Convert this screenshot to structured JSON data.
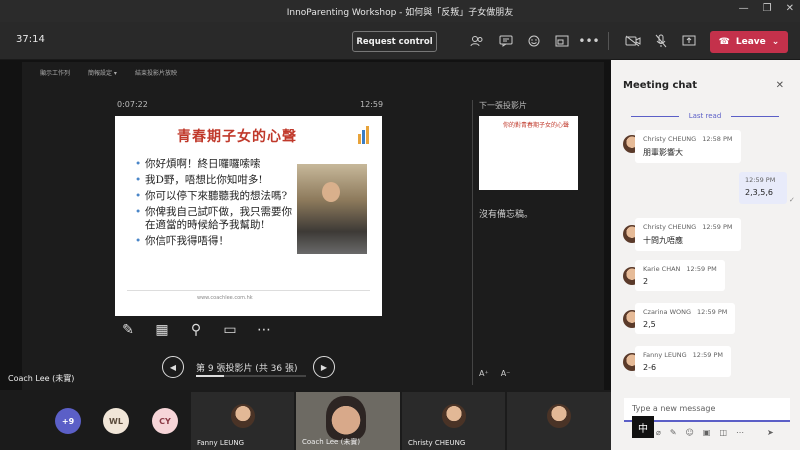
{
  "window": {
    "title": "InnoParenting Workshop - 如何與「反叛」子女做朋友",
    "controls": [
      "—",
      "❐",
      "✕"
    ]
  },
  "toolbar": {
    "timer": "37:14",
    "request_control": "Request control",
    "leave": "Leave",
    "icons": [
      "people-icon",
      "chat-icon",
      "reactions-icon",
      "rooms-icon",
      "more-icon",
      "camera-off-icon",
      "mic-off-icon",
      "share-icon"
    ]
  },
  "presentation": {
    "toolbar_items": [
      "顯示工作列",
      "簡報設定 ▾",
      "結束投影片放映"
    ],
    "elapsed": "0:07:22",
    "clock": "12:59",
    "slide": {
      "title": "青春期子女的心聲",
      "bullets": [
        "你好煩啊！終日囉囉嗦嗦",
        "我D野，唔想比你知咁多!",
        "你可以停下來聽聽我的想法嗎?",
        "你俾我自己試吓做，我只需要你在適當的時候給予我幫助!",
        "你信吓我得唔得！"
      ],
      "footer_url": "www.coachlee.com.hk"
    },
    "slide_counter": "第 9 張投影片 (共 36 張)",
    "progress": 0.25,
    "next_label": "下一張投影片",
    "next_title": "你的對青春期子女的心聲",
    "notes": "沒有備忘稿。",
    "presenter": "Coach Lee (未實)"
  },
  "participants": {
    "circles": [
      {
        "label": "+9",
        "color": "#5b5fc7",
        "text": "#fff"
      },
      {
        "label": "WL",
        "color": "#f1e6d8",
        "text": "#5a4a3a"
      },
      {
        "label": "CY",
        "color": "#f6d5d8",
        "text": "#8a3a45"
      }
    ],
    "tiles": [
      "Fanny LEUNG",
      "Coach Lee (未實)",
      "Christy CHEUNG",
      ""
    ]
  },
  "chat": {
    "header": "Meeting chat",
    "last_read": "Last read",
    "messages": [
      {
        "name": "Christy CHEUNG",
        "time": "12:58 PM",
        "text": "朋輩影響大"
      },
      {
        "name": "Christy CHEUNG",
        "time": "12:59 PM",
        "text": "十問九唔應"
      },
      {
        "name": "Karie CHAN",
        "time": "12:59 PM",
        "text": "2"
      },
      {
        "name": "Czarina WONG",
        "time": "12:59 PM",
        "text": "2,5"
      },
      {
        "name": "Fanny LEUNG",
        "time": "12:59 PM",
        "text": "2-6"
      }
    ],
    "mine": {
      "time": "12:59 PM",
      "text": "2,3,5,6"
    },
    "compose_placeholder": "Type a new message",
    "ime": "中"
  }
}
